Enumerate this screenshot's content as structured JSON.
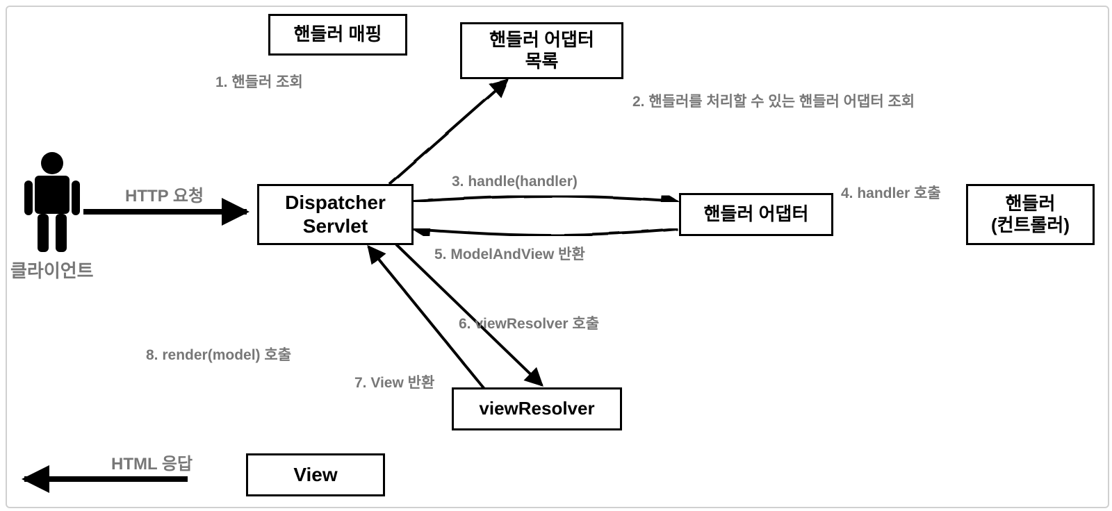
{
  "nodes": {
    "client_label": "클라이언트",
    "handler_mapping": "핸들러 매핑",
    "handler_adapter_list_l1": "핸들러 어댑터",
    "handler_adapter_list_l2": "목록",
    "dispatcher_l1": "Dispatcher",
    "dispatcher_l2": "Servlet",
    "handler_adapter": "핸들러 어댑터",
    "handler_l1": "핸들러",
    "handler_l2": "(컨트롤러)",
    "view_resolver": "viewResolver",
    "view": "View"
  },
  "steps": {
    "s1": "1. 핸들러 조회",
    "s2": "2. 핸들러를 처리할 수 있는 핸들러 어댑터 조회",
    "s3": "3. handle(handler)",
    "s4": "4. handler 호출",
    "s5": "5. ModelAndView 반환",
    "s6": "6. viewResolver 호출",
    "s7": "7. View 반환",
    "s8": "8. render(model) 호출"
  },
  "io": {
    "request": "HTTP 요청",
    "response": "HTML 응답"
  }
}
